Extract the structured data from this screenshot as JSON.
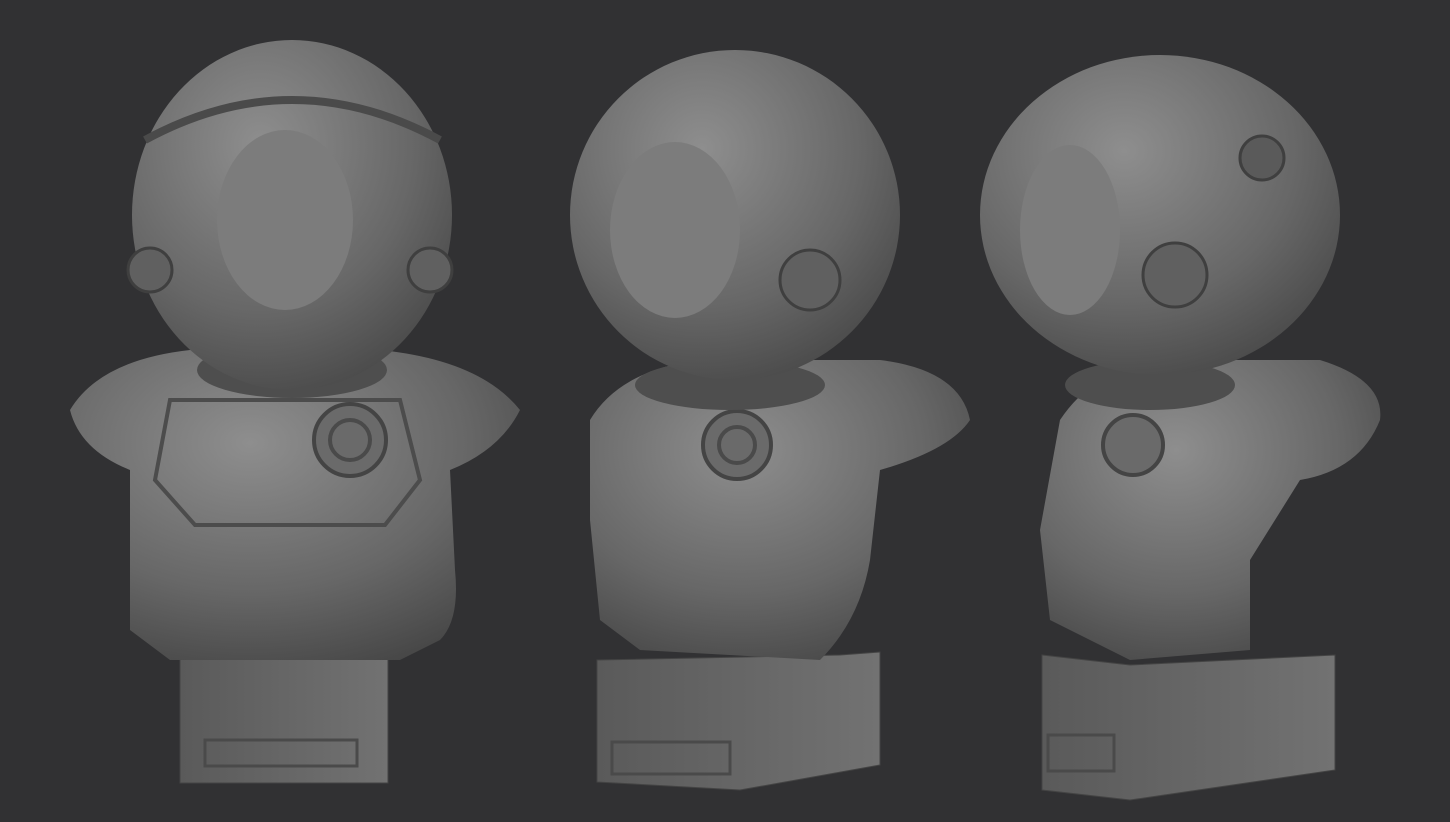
{
  "scene": {
    "background_color": "#313133",
    "model_color": "#6f6f6f",
    "model_shadow_color": "#3e3e3e",
    "model_highlight_color": "#9a9a9a",
    "views": [
      "front",
      "three-quarter",
      "profile"
    ]
  }
}
